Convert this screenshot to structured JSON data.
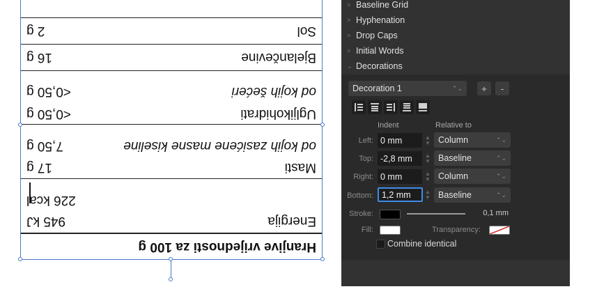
{
  "nutrition_table": {
    "title": "Hranjive vrijednosti za 100 g",
    "rows": [
      {
        "name": "Energija",
        "value": "945 kJ"
      },
      {
        "name": "",
        "value": "226 kcal"
      },
      {
        "name": "Masti",
        "value": "17 g"
      },
      {
        "name": "od kojih zasićene masne kiseline",
        "value": "7,50 g"
      },
      {
        "name": "Ugljikohidrati",
        "value": "<0,50 g"
      },
      {
        "name": "od kojih šećeri",
        "value": "<0,50 g"
      },
      {
        "name": "Bjelančevine",
        "value": "16 g"
      },
      {
        "name": "Sol",
        "value": "2 g"
      }
    ]
  },
  "panel": {
    "sections": [
      "Baseline Grid",
      "Hyphenation",
      "Drop Caps",
      "Initial Words",
      "Decorations"
    ],
    "decoration_select": "Decoration 1",
    "add_label": "+",
    "remove_label": "-",
    "col_indent": "Indent",
    "col_relative": "Relative to",
    "fields": [
      {
        "label": "Left:",
        "value": "0 mm",
        "relative": "Column"
      },
      {
        "label": "Top:",
        "value": "-2,8 mm",
        "relative": "Baseline"
      },
      {
        "label": "Right:",
        "value": "0 mm",
        "relative": "Column"
      },
      {
        "label": "Bottom:",
        "value": "1,2 mm",
        "relative": "Baseline"
      }
    ],
    "stroke_label": "Stroke:",
    "stroke_width": "0,1 mm",
    "fill_label": "Fill:",
    "transparency_label": "Transparency:",
    "combine_label": "Combine identical",
    "colors": {
      "stroke_swatch": "#000000",
      "fill_swatch": "#ffffff",
      "accent": "#3d8ce8"
    }
  }
}
